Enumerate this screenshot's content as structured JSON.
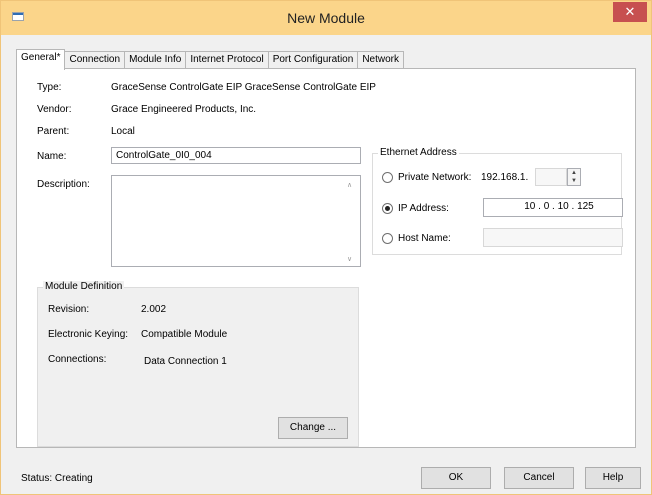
{
  "window": {
    "title": "New Module",
    "close_glyph": "✕"
  },
  "tabs": [
    {
      "label": "General*"
    },
    {
      "label": "Connection"
    },
    {
      "label": "Module Info"
    },
    {
      "label": "Internet Protocol"
    },
    {
      "label": "Port Configuration"
    },
    {
      "label": "Network"
    }
  ],
  "general": {
    "type_label": "Type:",
    "type_value": "GraceSense ControlGate EIP GraceSense ControlGate EIP",
    "vendor_label": "Vendor:",
    "vendor_value": "Grace Engineered Products, Inc.",
    "parent_label": "Parent:",
    "parent_value": "Local",
    "name_label": "Name:",
    "name_value": "ControlGate_0I0_004",
    "description_label": "Description:",
    "description_value": ""
  },
  "module_definition": {
    "title": "Module Definition",
    "revision_label": "Revision:",
    "revision_value": "2.002",
    "keying_label": "Electronic Keying:",
    "keying_value": "Compatible Module",
    "connections_label": "Connections:",
    "connections_value": "Data Connection 1",
    "change_button": "Change ..."
  },
  "ethernet": {
    "title": "Ethernet Address",
    "private_label": "Private Network:",
    "private_prefix": "192.168.1.",
    "ip_label": "IP Address:",
    "ip_value": "10 . 0 . 10 . 125",
    "host_label": "Host Name:",
    "selected": "ip"
  },
  "footer": {
    "status": "Status: Creating",
    "ok": "OK",
    "cancel": "Cancel",
    "help": "Help"
  },
  "icons": {
    "app": "app-icon",
    "close": "close-icon",
    "scroll_up": "scroll-up-icon",
    "scroll_down": "scroll-down-icon",
    "spinner": "spinner-icon"
  }
}
